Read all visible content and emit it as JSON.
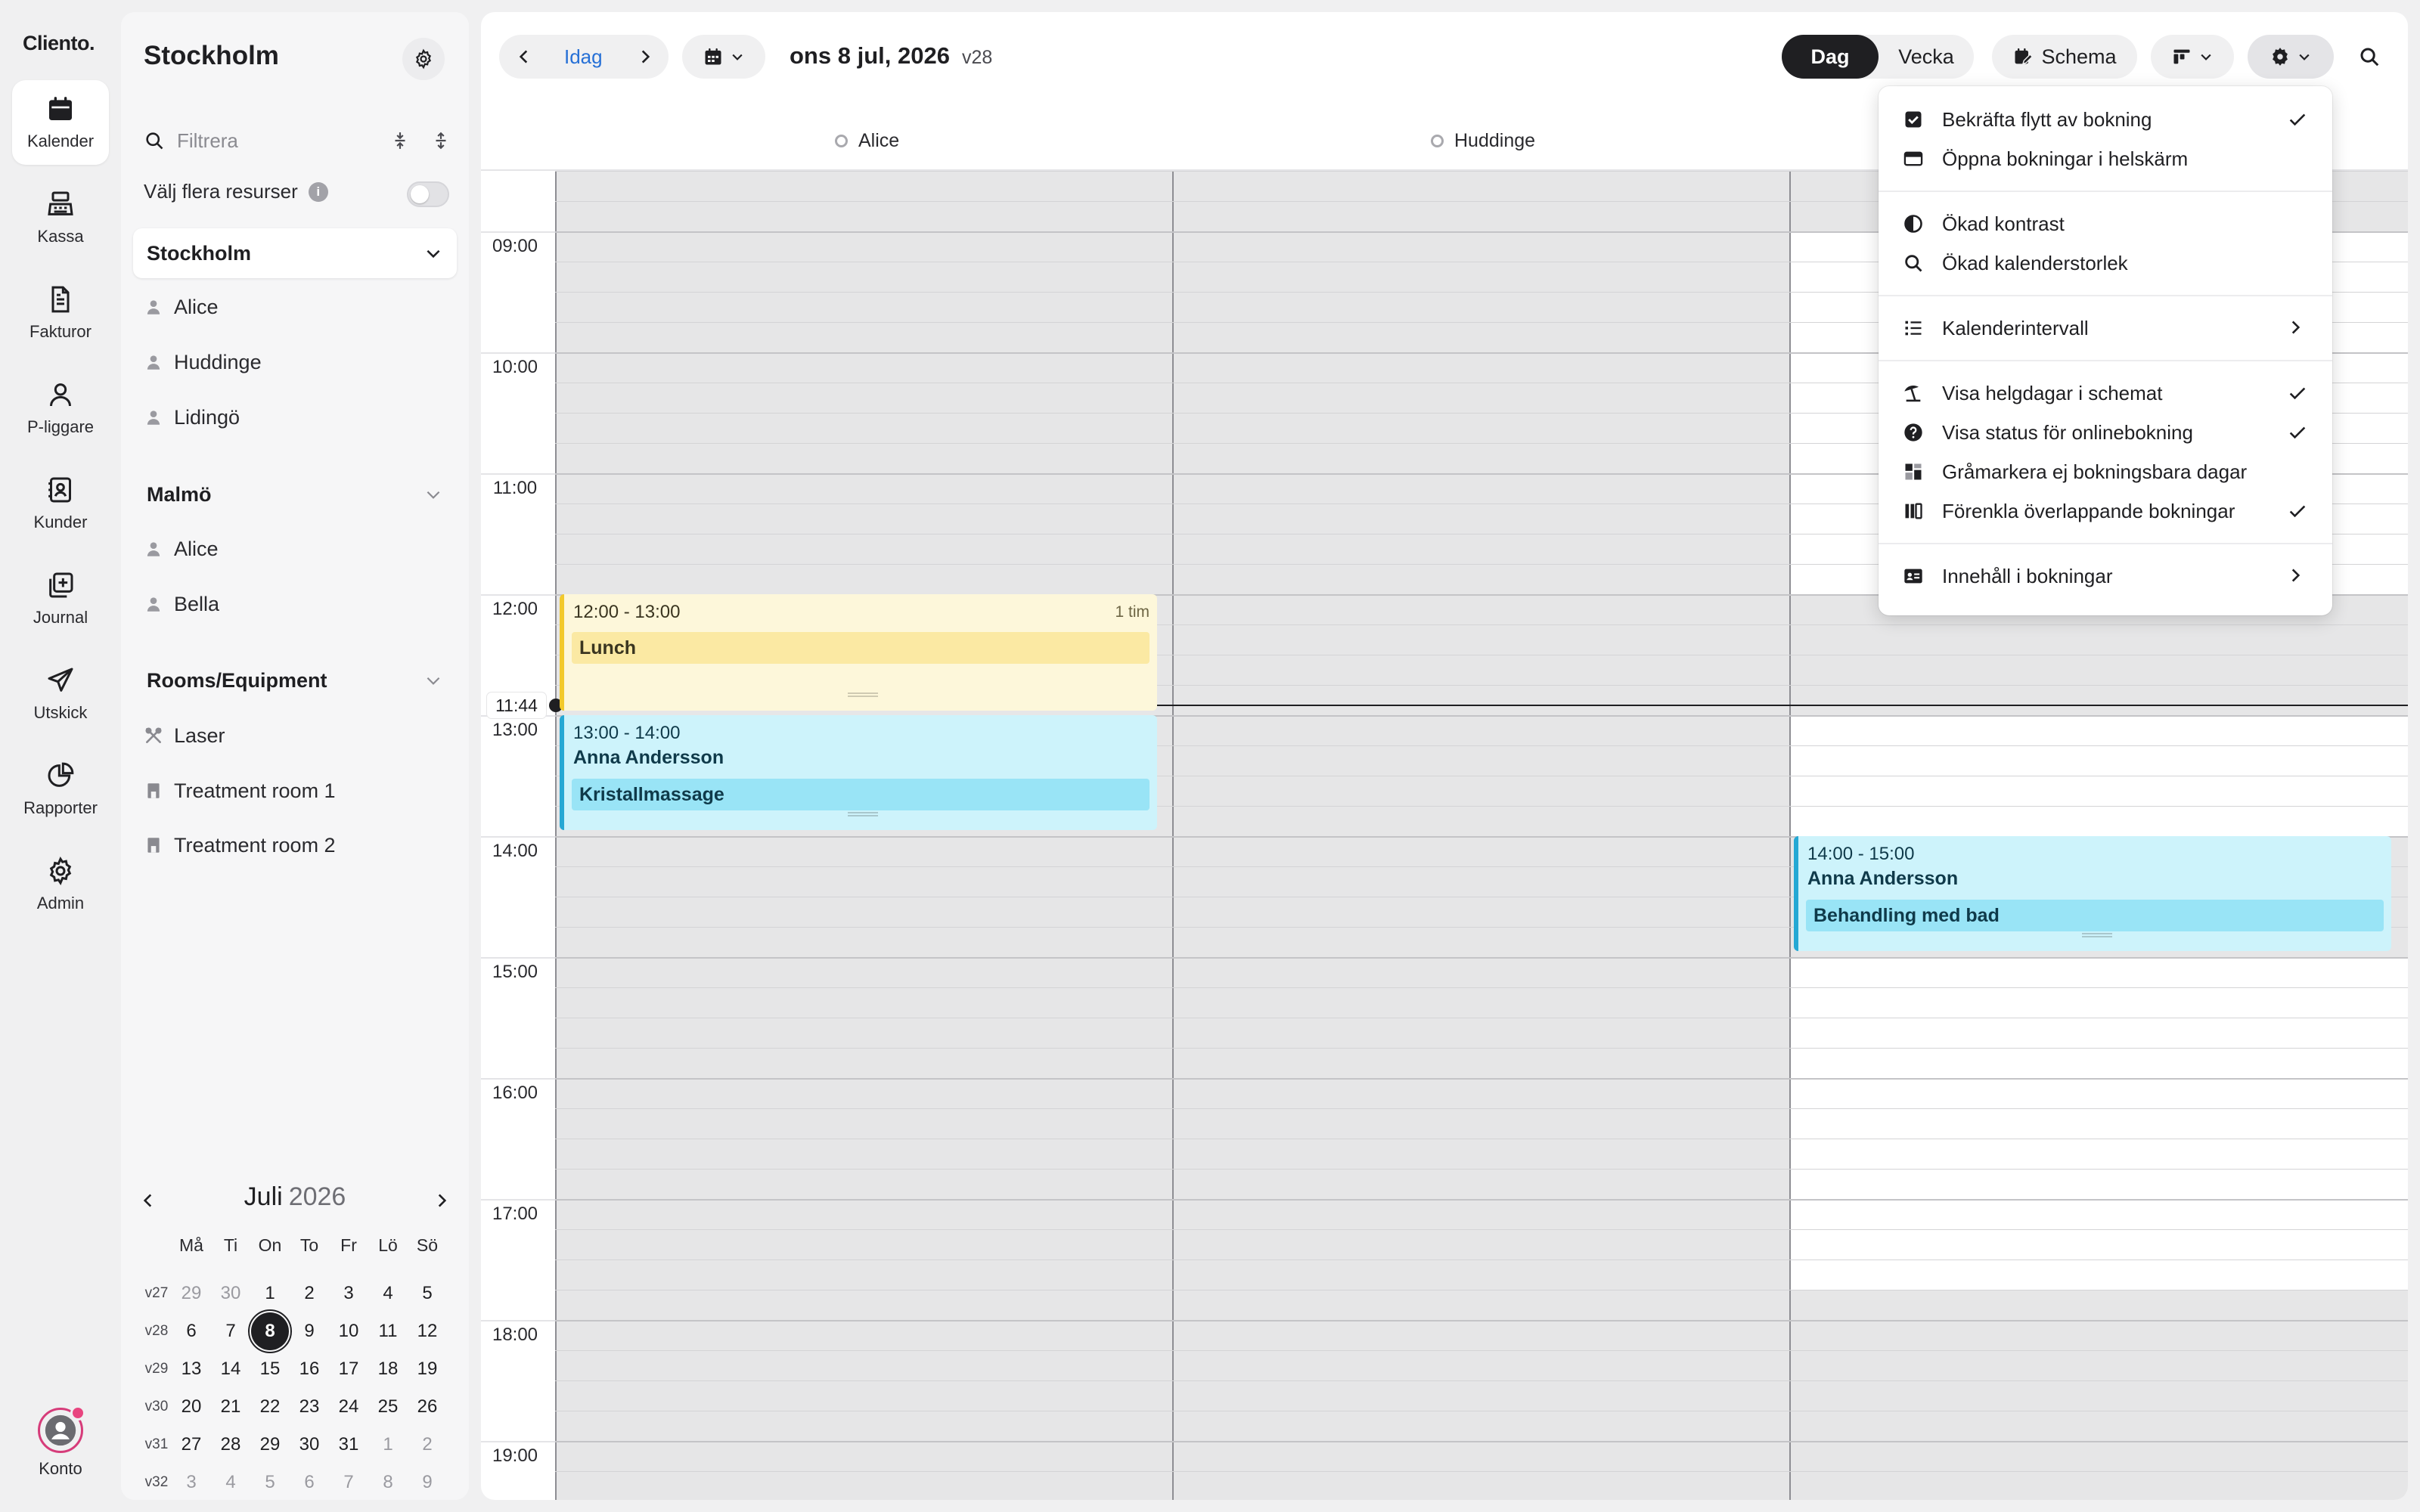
{
  "brand": "Cliento.",
  "nav": [
    {
      "label": "Kalender",
      "icon": "calendar-icon",
      "active": true
    },
    {
      "label": "Kassa",
      "icon": "cash-register-icon"
    },
    {
      "label": "Fakturor",
      "icon": "invoice-icon"
    },
    {
      "label": "P-liggare",
      "icon": "person-icon"
    },
    {
      "label": "Kunder",
      "icon": "contacts-icon"
    },
    {
      "label": "Journal",
      "icon": "journal-icon"
    },
    {
      "label": "Utskick",
      "icon": "send-icon"
    },
    {
      "label": "Rapporter",
      "icon": "pie-chart-icon"
    },
    {
      "label": "Admin",
      "icon": "gear-icon"
    }
  ],
  "account": {
    "label": "Konto"
  },
  "sidebar": {
    "title": "Stockholm",
    "filter_placeholder": "Filtrera",
    "multi_label": "Välj flera resurser",
    "groups": [
      {
        "name": "Stockholm",
        "resources": [
          "Alice",
          "Huddinge",
          "Lidingö"
        ]
      },
      {
        "name": "Malmö",
        "resources": [
          "Alice",
          "Bella"
        ]
      },
      {
        "name": "Rooms/Equipment",
        "resources": [
          "Laser",
          "Treatment room 1",
          "Treatment room 2"
        ]
      }
    ]
  },
  "mini_calendar": {
    "month": "Juli",
    "year": "2026",
    "weekdays": [
      "Må",
      "Ti",
      "On",
      "To",
      "Fr",
      "Lö",
      "Sö"
    ],
    "weeks": [
      {
        "wk": "v27",
        "days": [
          "29",
          "30",
          "1",
          "2",
          "3",
          "4",
          "5"
        ]
      },
      {
        "wk": "v28",
        "days": [
          "6",
          "7",
          "8",
          "9",
          "10",
          "11",
          "12"
        ]
      },
      {
        "wk": "v29",
        "days": [
          "13",
          "14",
          "15",
          "16",
          "17",
          "18",
          "19"
        ]
      },
      {
        "wk": "v30",
        "days": [
          "20",
          "21",
          "22",
          "23",
          "24",
          "25",
          "26"
        ]
      },
      {
        "wk": "v31",
        "days": [
          "27",
          "28",
          "29",
          "30",
          "31",
          "1",
          "2"
        ]
      },
      {
        "wk": "v32",
        "days": [
          "3",
          "4",
          "5",
          "6",
          "7",
          "8",
          "9"
        ]
      }
    ],
    "selected": "8"
  },
  "toolbar": {
    "today": "Idag",
    "date": "ons 8 jul, 2026",
    "week": "v28",
    "view_day": "Dag",
    "view_week": "Vecka",
    "schema": "Schema"
  },
  "columns": [
    {
      "name": "Alice"
    },
    {
      "name": "Huddinge"
    }
  ],
  "hours": [
    "09:00",
    "10:00",
    "11:00",
    "12:00",
    "13:00",
    "14:00",
    "15:00",
    "16:00",
    "17:00",
    "18:00",
    "19:00"
  ],
  "now": "11:44",
  "events": [
    {
      "time": "12:00 - 13:00",
      "duration": "1 tim",
      "service": "Lunch"
    },
    {
      "time": "13:00 - 14:00",
      "customer": "Anna Andersson",
      "service": "Kristallmassage"
    },
    {
      "time": "14:00 - 15:00",
      "customer": "Anna Andersson",
      "service": "Behandling med bad"
    }
  ],
  "settings_menu": [
    {
      "label": "Bekräfta flytt av bokning",
      "checked": true
    },
    {
      "label": "Öppna bokningar i helskärm"
    },
    {
      "label": "Ökad kontrast"
    },
    {
      "label": "Ökad kalenderstorlek"
    },
    {
      "label": "Kalenderintervall",
      "submenu": true
    },
    {
      "label": "Visa helgdagar i schemat",
      "checked": true
    },
    {
      "label": "Visa status för onlinebokning",
      "checked": true
    },
    {
      "label": "Gråmarkera ej bokningsbara dagar"
    },
    {
      "label": "Förenkla överlappande bokningar",
      "checked": true
    },
    {
      "label": "Innehåll i bokningar",
      "submenu": true
    }
  ]
}
